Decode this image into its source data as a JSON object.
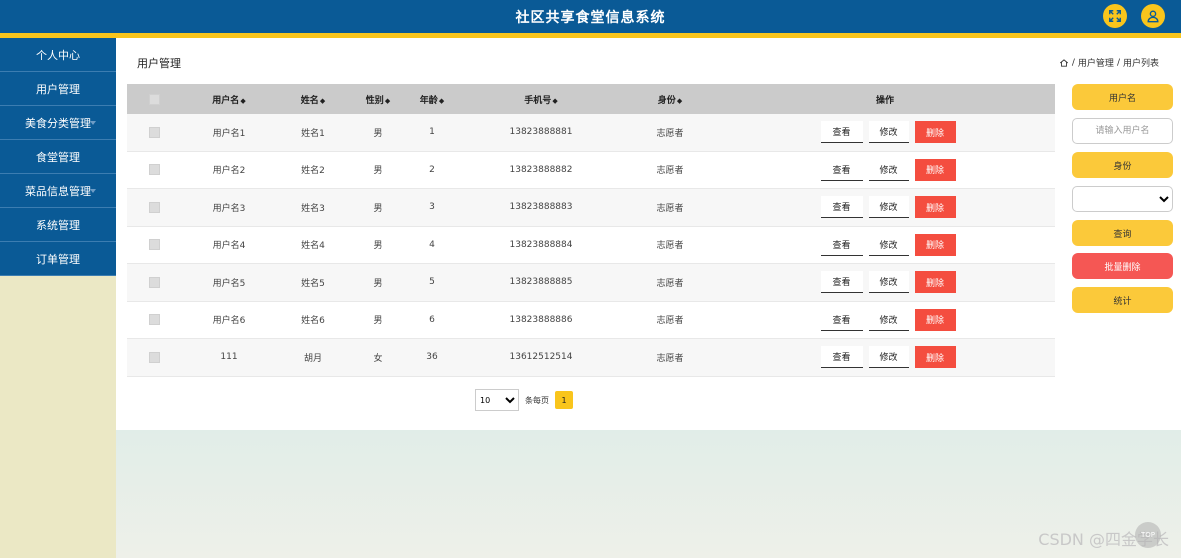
{
  "header": {
    "title": "社区共享食堂信息系统"
  },
  "sidebar": {
    "items": [
      {
        "label": "个人中心",
        "caret": false
      },
      {
        "label": "用户管理",
        "caret": false
      },
      {
        "label": "美食分类管理",
        "caret": true
      },
      {
        "label": "食堂管理",
        "caret": false
      },
      {
        "label": "菜品信息管理",
        "caret": true
      },
      {
        "label": "系统管理",
        "caret": false
      },
      {
        "label": "订单管理",
        "caret": false
      }
    ]
  },
  "page": {
    "title": "用户管理",
    "breadcrumb": [
      "用户管理",
      "用户列表"
    ]
  },
  "table": {
    "columns": {
      "username": "用户名",
      "name": "姓名",
      "sex": "性别",
      "age": "年龄",
      "phone": "手机号",
      "role": "身份",
      "ops": "操作"
    },
    "actions": {
      "view": "查看",
      "edit": "修改",
      "delete": "删除"
    },
    "rows": [
      {
        "username": "用户名1",
        "name": "姓名1",
        "sex": "男",
        "age": "1",
        "phone": "13823888881",
        "role": "志愿者"
      },
      {
        "username": "用户名2",
        "name": "姓名2",
        "sex": "男",
        "age": "2",
        "phone": "13823888882",
        "role": "志愿者"
      },
      {
        "username": "用户名3",
        "name": "姓名3",
        "sex": "男",
        "age": "3",
        "phone": "13823888883",
        "role": "志愿者"
      },
      {
        "username": "用户名4",
        "name": "姓名4",
        "sex": "男",
        "age": "4",
        "phone": "13823888884",
        "role": "志愿者"
      },
      {
        "username": "用户名5",
        "name": "姓名5",
        "sex": "男",
        "age": "5",
        "phone": "13823888885",
        "role": "志愿者"
      },
      {
        "username": "用户名6",
        "name": "姓名6",
        "sex": "男",
        "age": "6",
        "phone": "13823888886",
        "role": "志愿者"
      },
      {
        "username": "111",
        "name": "胡月",
        "sex": "女",
        "age": "36",
        "phone": "13612512514",
        "role": "志愿者"
      }
    ]
  },
  "pager": {
    "page_size": "10",
    "per_page_label": "条每页",
    "current_page": "1"
  },
  "filters": {
    "username_label": "用户名",
    "username_placeholder": "请输入用户名",
    "role_label": "身份",
    "role_selected": "",
    "search_label": "查询",
    "batch_delete_label": "批量删除",
    "stats_label": "统计"
  },
  "overlay": {
    "watermark": "CSDN @四金学长",
    "top_label": "TOP"
  },
  "colors": {
    "header": "#0a5a96",
    "accent": "#f9c51c",
    "danger": "#f44d3f",
    "sidebar_bg": "#ebe8c5"
  }
}
